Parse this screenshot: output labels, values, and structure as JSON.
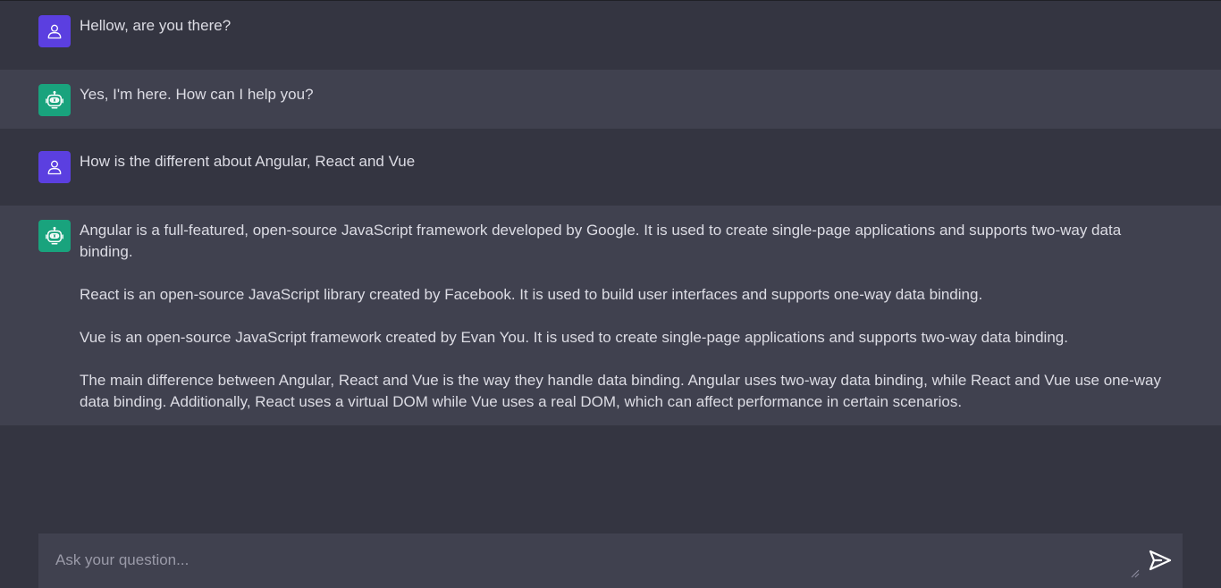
{
  "messages": [
    {
      "role": "user",
      "icon": "user-icon",
      "paragraphs": [
        "Hellow, are you there?"
      ]
    },
    {
      "role": "bot",
      "icon": "robot-icon",
      "paragraphs": [
        " Yes, I'm here. How can I help you?"
      ]
    },
    {
      "role": "user",
      "icon": "user-icon",
      "paragraphs": [
        "How is the different about Angular, React and Vue"
      ]
    },
    {
      "role": "bot",
      "icon": "robot-icon",
      "paragraphs": [
        " Angular is a full-featured, open-source JavaScript framework developed by Google. It is used to create single-page applications and supports two-way data binding.",
        "React is an open-source JavaScript library created by Facebook. It is used to build user interfaces and supports one-way data binding.",
        "Vue is an open-source JavaScript framework created by Evan You. It is used to create single-page applications and supports two-way data binding.",
        "The main difference between Angular, React and Vue is the way they handle data binding. Angular uses two-way data binding, while React and Vue use one-way data binding. Additionally, React uses a virtual DOM while Vue uses a real DOM, which can affect performance in certain scenarios."
      ]
    }
  ],
  "input": {
    "placeholder": "Ask your question...",
    "value": ""
  },
  "send": {
    "icon": "send-icon"
  },
  "colors": {
    "background": "#343541",
    "bot_row": "#40414f",
    "user_avatar": "#5b3fe0",
    "bot_avatar": "#19a37d",
    "text": "#dcdce4"
  }
}
